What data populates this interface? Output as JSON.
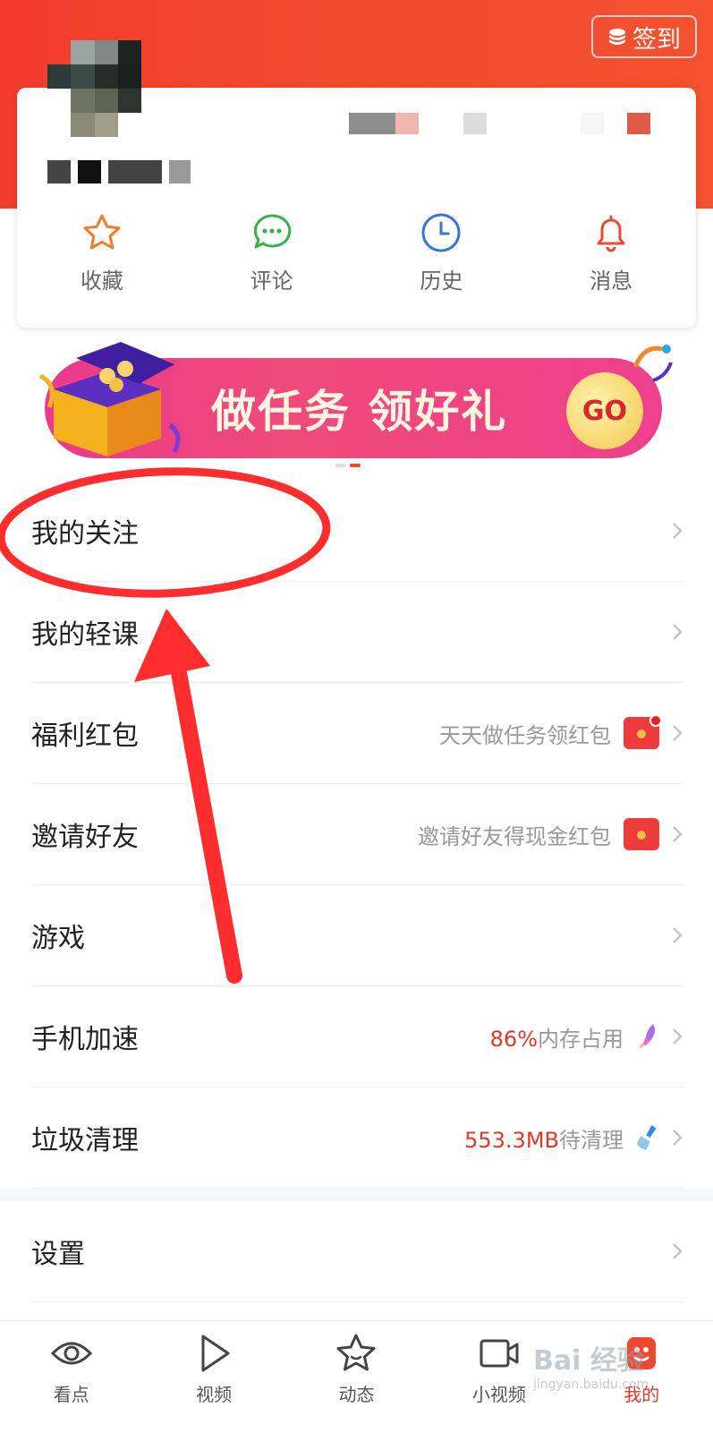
{
  "header": {
    "signin_label": "签到",
    "accent_color": "#f24430"
  },
  "quick_actions": [
    {
      "label": "收藏",
      "icon": "star-icon",
      "color": "#f07d2b"
    },
    {
      "label": "评论",
      "icon": "chat-bubble-icon",
      "color": "#2fb34a"
    },
    {
      "label": "历史",
      "icon": "clock-icon",
      "color": "#3a74d8"
    },
    {
      "label": "消息",
      "icon": "bell-icon",
      "color": "#f0482e"
    }
  ],
  "banner": {
    "text": "做任务 领好礼",
    "go_label": "GO"
  },
  "menu": [
    {
      "title": "我的关注"
    },
    {
      "title": "我的轻课"
    },
    {
      "title": "福利红包",
      "sub": "天天做任务领红包"
    },
    {
      "title": "邀请好友",
      "sub": "邀请好友得现金红包"
    },
    {
      "title": "游戏"
    },
    {
      "title": "手机加速",
      "sub_highlight": "86%",
      "sub": "内存占用"
    },
    {
      "title": "垃圾清理",
      "sub_highlight": "553.3MB",
      "sub": "待清理"
    },
    {
      "title": "设置"
    }
  ],
  "tabbar": [
    {
      "label": "看点",
      "icon": "eye-icon"
    },
    {
      "label": "视频",
      "icon": "play-icon"
    },
    {
      "label": "动态",
      "icon": "star-face-icon"
    },
    {
      "label": "小视频",
      "icon": "video-camera-icon"
    },
    {
      "label": "我的",
      "icon": "profile-icon",
      "active": true
    }
  ],
  "watermark": {
    "text": "Bai 经验",
    "subtext": "jingyan.baidu.com"
  }
}
